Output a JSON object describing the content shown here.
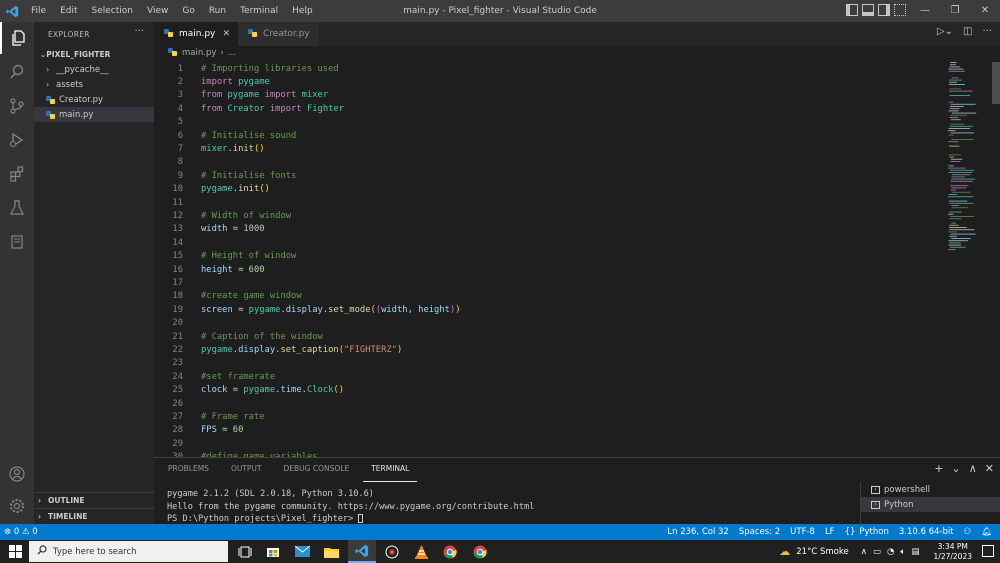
{
  "window": {
    "title": "main.py - Pixel_fighter - Visual Studio Code",
    "menu": [
      "File",
      "Edit",
      "Selection",
      "View",
      "Go",
      "Run",
      "Terminal",
      "Help"
    ],
    "controls": {
      "minimize": "—",
      "restore": "❐",
      "close": "✕"
    }
  },
  "activity_bar": {
    "items": [
      "explorer-icon",
      "search-icon",
      "source-control-icon",
      "run-debug-icon",
      "extensions-icon",
      "testing-icon",
      "remote-explorer-icon"
    ],
    "bottom": [
      "account-icon",
      "settings-gear-icon"
    ]
  },
  "sidebar": {
    "title": "EXPLORER",
    "more": "···",
    "folder": "PIXEL_FIGHTER",
    "tree": [
      {
        "label": "__pycache__",
        "type": "folder"
      },
      {
        "label": "assets",
        "type": "folder"
      },
      {
        "label": "Creator.py",
        "type": "python"
      },
      {
        "label": "main.py",
        "type": "python",
        "selected": true
      }
    ],
    "sections": [
      "OUTLINE",
      "TIMELINE"
    ]
  },
  "tabs": [
    {
      "label": "main.py",
      "active": true,
      "close": "✕"
    },
    {
      "label": "Creator.py",
      "active": false
    }
  ],
  "breadcrumb": {
    "file": "main.py",
    "sep": "›",
    "rest": "..."
  },
  "editor": {
    "lines": [
      {
        "n": "1",
        "tokens": [
          [
            "cmt",
            "# Importing libraries used"
          ]
        ]
      },
      {
        "n": "2",
        "tokens": [
          [
            "kw",
            "import "
          ],
          [
            "mod",
            "pygame"
          ]
        ]
      },
      {
        "n": "3",
        "tokens": [
          [
            "kw",
            "from "
          ],
          [
            "mod",
            "pygame "
          ],
          [
            "kw",
            "import "
          ],
          [
            "mod",
            "mixer"
          ]
        ]
      },
      {
        "n": "4",
        "tokens": [
          [
            "kw",
            "from "
          ],
          [
            "mod",
            "Creator "
          ],
          [
            "kw",
            "import "
          ],
          [
            "mod",
            "Fighter"
          ]
        ]
      },
      {
        "n": "5",
        "tokens": []
      },
      {
        "n": "6",
        "tokens": [
          [
            "cmt",
            "# Initialise sound"
          ]
        ]
      },
      {
        "n": "7",
        "tokens": [
          [
            "mod",
            "mixer"
          ],
          [
            "op",
            "."
          ],
          [
            "fn",
            "init"
          ],
          [
            "br",
            "()"
          ]
        ]
      },
      {
        "n": "8",
        "tokens": []
      },
      {
        "n": "9",
        "tokens": [
          [
            "cmt",
            "# Initialise fonts"
          ]
        ]
      },
      {
        "n": "10",
        "tokens": [
          [
            "mod",
            "pygame"
          ],
          [
            "op",
            "."
          ],
          [
            "fn",
            "init"
          ],
          [
            "br",
            "()"
          ]
        ]
      },
      {
        "n": "11",
        "tokens": []
      },
      {
        "n": "12",
        "tokens": [
          [
            "cmt",
            "# Width of window"
          ]
        ]
      },
      {
        "n": "13",
        "tokens": [
          [
            "var",
            "width"
          ],
          [
            "op",
            " = "
          ],
          [
            "num",
            "1000"
          ]
        ]
      },
      {
        "n": "14",
        "tokens": []
      },
      {
        "n": "15",
        "tokens": [
          [
            "cmt",
            "# Height of window"
          ]
        ]
      },
      {
        "n": "16",
        "tokens": [
          [
            "var",
            "height"
          ],
          [
            "op",
            " = "
          ],
          [
            "num",
            "600"
          ]
        ]
      },
      {
        "n": "17",
        "tokens": []
      },
      {
        "n": "18",
        "tokens": [
          [
            "cmt",
            "#create game window"
          ]
        ]
      },
      {
        "n": "19",
        "tokens": [
          [
            "var",
            "screen"
          ],
          [
            "op",
            " = "
          ],
          [
            "mod",
            "pygame"
          ],
          [
            "op",
            "."
          ],
          [
            "var",
            "display"
          ],
          [
            "op",
            "."
          ],
          [
            "fn",
            "set_mode"
          ],
          [
            "br",
            "("
          ],
          [
            "br2",
            "("
          ],
          [
            "var",
            "width"
          ],
          [
            "op",
            ", "
          ],
          [
            "var",
            "height"
          ],
          [
            "br2",
            ")"
          ],
          [
            "br",
            ")"
          ]
        ]
      },
      {
        "n": "20",
        "tokens": []
      },
      {
        "n": "21",
        "tokens": [
          [
            "cmt",
            "# Caption of the window"
          ]
        ]
      },
      {
        "n": "22",
        "tokens": [
          [
            "mod",
            "pygame"
          ],
          [
            "op",
            "."
          ],
          [
            "var",
            "display"
          ],
          [
            "op",
            "."
          ],
          [
            "fn",
            "set_caption"
          ],
          [
            "br",
            "("
          ],
          [
            "str",
            "\"FIGHTERZ\""
          ],
          [
            "br",
            ")"
          ]
        ]
      },
      {
        "n": "23",
        "tokens": []
      },
      {
        "n": "24",
        "tokens": [
          [
            "cmt",
            "#set framerate"
          ]
        ]
      },
      {
        "n": "25",
        "tokens": [
          [
            "var",
            "clock"
          ],
          [
            "op",
            " = "
          ],
          [
            "mod",
            "pygame"
          ],
          [
            "op",
            "."
          ],
          [
            "var",
            "time"
          ],
          [
            "op",
            "."
          ],
          [
            "mod",
            "Clock"
          ],
          [
            "br",
            "()"
          ]
        ]
      },
      {
        "n": "26",
        "tokens": []
      },
      {
        "n": "27",
        "tokens": [
          [
            "cmt",
            "# Frame rate"
          ]
        ]
      },
      {
        "n": "28",
        "tokens": [
          [
            "var",
            "FPS"
          ],
          [
            "op",
            " = "
          ],
          [
            "num",
            "60"
          ]
        ]
      },
      {
        "n": "29",
        "tokens": []
      },
      {
        "n": "30",
        "tokens": [
          [
            "cmt",
            "#define game variables"
          ]
        ]
      }
    ]
  },
  "panel": {
    "tabs": [
      "PROBLEMS",
      "OUTPUT",
      "DEBUG CONSOLE",
      "TERMINAL"
    ],
    "active_tab": "TERMINAL",
    "actions": [
      "+",
      "⌄",
      "∧",
      "✕"
    ],
    "terminal_lines": [
      "pygame 2.1.2 (SDL 2.0.18, Python 3.10.6)",
      "Hello from the pygame community. https://www.pygame.org/contribute.html",
      "PS D:\\Python projects\\Pixel_fighter> "
    ],
    "terminals": [
      {
        "label": "powershell",
        "selected": false
      },
      {
        "label": "Python",
        "selected": true
      }
    ]
  },
  "statusbar": {
    "errors": "0",
    "warnings": "0",
    "position": "Ln 236, Col 32",
    "spaces": "Spaces: 2",
    "encoding": "UTF-8",
    "eol": "LF",
    "language": "Python",
    "interpreter": "3.10.6 64-bit"
  },
  "taskbar": {
    "search_placeholder": "Type here to search",
    "apps": [
      "task-view-icon",
      "store-icon",
      "mail-icon",
      "file-explorer-icon",
      "vscode-icon",
      "app-icon",
      "vlc-icon",
      "chrome-icon",
      "chrome-icon"
    ],
    "weather": "21°C Smoke",
    "time": "3:34 PM",
    "date": "1/27/2023"
  },
  "colors": {
    "accent": "#007acc",
    "titlebar": "#3c3c3c",
    "editor_bg": "#1e1e1e"
  }
}
